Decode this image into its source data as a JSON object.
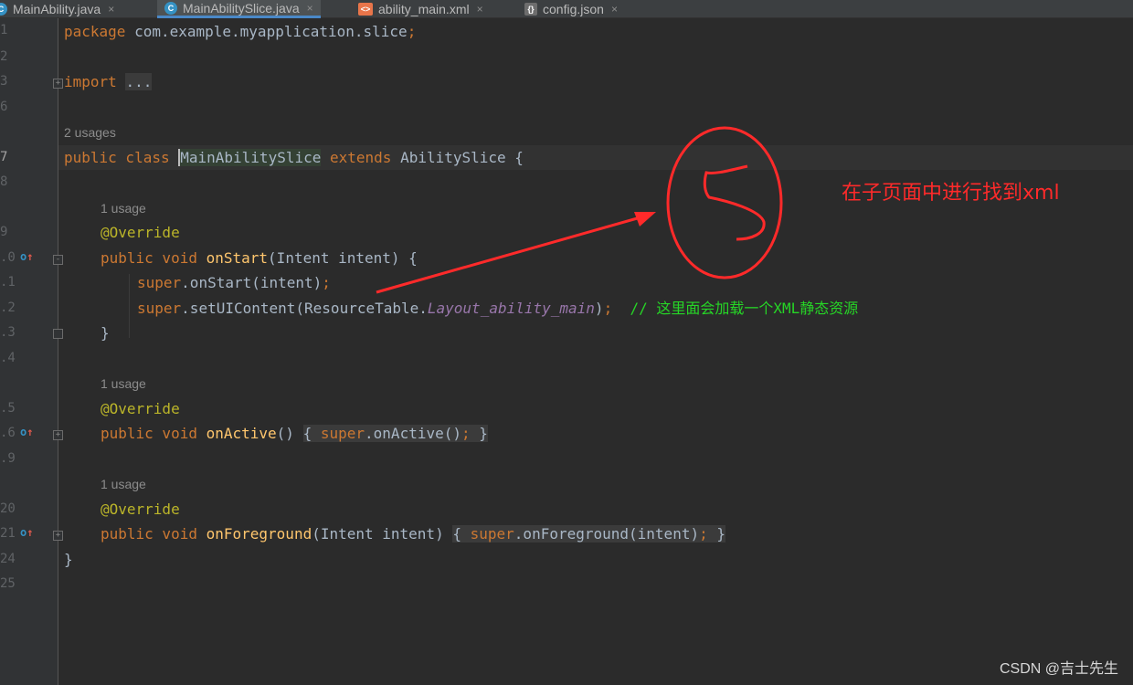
{
  "tabs": [
    {
      "label": "MainAbility.java",
      "icon": "java-class-icon",
      "active": false
    },
    {
      "label": "MainAbilitySlice.java",
      "icon": "java-class-icon",
      "active": true
    },
    {
      "label": "ability_main.xml",
      "icon": "xml-file-icon",
      "active": false
    },
    {
      "label": "config.json",
      "icon": "json-file-icon",
      "active": false
    }
  ],
  "tab_icon_letters": {
    "java": "C",
    "xml": "<>",
    "json": "{}"
  },
  "close_glyph": "×",
  "gutter": {
    "line_numbers": [
      "1",
      "2",
      "3",
      "6",
      "7",
      "8",
      "9",
      ".0",
      ".1",
      ".2",
      ".3",
      ".4",
      ".5",
      ".6",
      ".9",
      "20",
      "21",
      "24",
      "25"
    ]
  },
  "code": {
    "line1": {
      "kw": "package",
      "rest": " com.example.myapplication.slice",
      "semi": ";"
    },
    "line3": {
      "kw": "import",
      "collapsed": "..."
    },
    "usages_class": "2 usages",
    "line7": {
      "kw": "public class",
      "name": "MainAbilitySlice",
      "kw2": "extends",
      "rest": " AbilitySlice {"
    },
    "usages_start": "1 usage",
    "annotation": "@Override",
    "line10": {
      "kw": "public void",
      "fn": "onStart",
      "rest": "(Intent intent) {"
    },
    "line11": {
      "kw": "super",
      "rest": ".onStart(intent)",
      "semi": ";"
    },
    "line12": {
      "kw": "super",
      "rest": ".setUIContent(ResourceTable.",
      "field": "Layout_ability_main",
      "tail": ")",
      "semi": ";",
      "comment": "// 这里面会加载一个XML静态资源"
    },
    "close_brace": "}",
    "usages_active": "1 usage",
    "line16": {
      "kw": "public void",
      "fn": "onActive",
      "paren": "()",
      "open": "{",
      "super": "super",
      "call": ".onActive()",
      "semi": ";",
      "close": "}"
    },
    "usages_fg": "1 usage",
    "line21": {
      "kw": "public void",
      "fn": "onForeground",
      "params": "(Intent intent)",
      "open": "{",
      "super": "super",
      "call": ".onForeground(intent)",
      "semi": ";",
      "close": "}"
    },
    "class_close": "}"
  },
  "annotation_text": "在子页面中进行找到xml",
  "watermark": "CSDN @吉士先生",
  "colors": {
    "annotation_red": "#ff2a2a",
    "keyword": "#cc7832",
    "function": "#ffc66d",
    "comment": "#26d626",
    "annotation": "#bbb529"
  }
}
